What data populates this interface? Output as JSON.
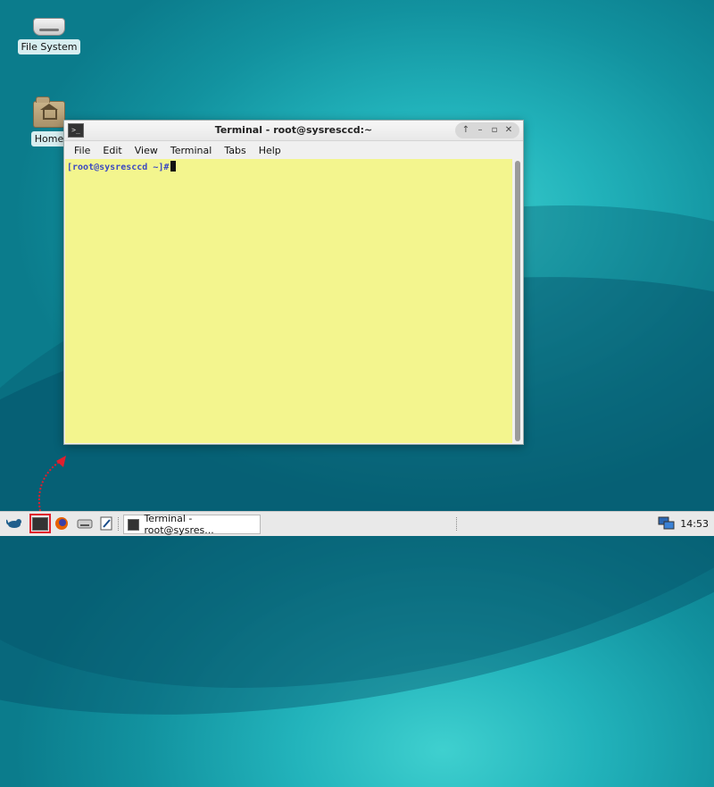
{
  "desktop": {
    "icons": [
      {
        "label": "File System",
        "icon": "drive-icon"
      },
      {
        "label": "Home",
        "icon": "home-folder-icon"
      }
    ]
  },
  "window": {
    "title": "Terminal - root@sysresccd:~",
    "buttons": {
      "up": "↑",
      "minimize": "–",
      "maximize": "▫",
      "close": "✕"
    },
    "menu": [
      "File",
      "Edit",
      "View",
      "Terminal",
      "Tabs",
      "Help"
    ],
    "prompt": "[root@sysresccd ~]#",
    "colors": {
      "terminal_bg": "#f3f58e",
      "prompt": "#3b48c2"
    }
  },
  "taskbar": {
    "task_label": "Terminal - root@sysres...",
    "clock": "14:53",
    "icons": [
      "xfce-mouse-icon",
      "terminal-icon",
      "firefox-icon",
      "drive-manager-icon",
      "text-editor-icon",
      "network-icon"
    ]
  },
  "annotation": {
    "color": "#e01f2d"
  }
}
